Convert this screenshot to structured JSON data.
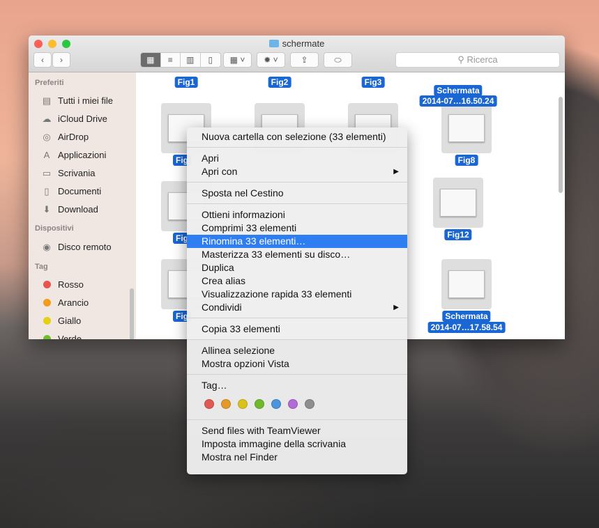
{
  "window": {
    "title": "schermate",
    "search_placeholder": "Ricerca"
  },
  "sidebar": {
    "sections": [
      {
        "title": "Preferiti",
        "items": [
          {
            "label": "Tutti i miei file",
            "icon": "all-files-icon"
          },
          {
            "label": "iCloud Drive",
            "icon": "cloud-icon"
          },
          {
            "label": "AirDrop",
            "icon": "airdrop-icon"
          },
          {
            "label": "Applicazioni",
            "icon": "applications-icon"
          },
          {
            "label": "Scrivania",
            "icon": "desktop-icon"
          },
          {
            "label": "Documenti",
            "icon": "documents-icon"
          },
          {
            "label": "Download",
            "icon": "download-icon"
          }
        ]
      },
      {
        "title": "Dispositivi",
        "items": [
          {
            "label": "Disco remoto",
            "icon": "disc-icon"
          }
        ]
      },
      {
        "title": "Tag",
        "items": [
          {
            "label": "Rosso",
            "color": "#e8534d"
          },
          {
            "label": "Arancio",
            "color": "#f39c1c"
          },
          {
            "label": "Giallo",
            "color": "#e6cf14"
          },
          {
            "label": "Verde",
            "color": "#6cc22a"
          }
        ]
      }
    ]
  },
  "files": {
    "fig1": "Fig1",
    "fig2": "Fig2",
    "fig3": "Fig3",
    "sch1a": "Schermata",
    "sch1b": "2014-07…16.50.24",
    "fig8": "Fig8",
    "fig12": "Fig12",
    "sch2a": "Schermata",
    "sch2b": "2014-07…17.58.54",
    "figA": "Fig",
    "figB": "Fig",
    "figC": "Fig"
  },
  "menu": {
    "new_folder": "Nuova cartella con selezione (33 elementi)",
    "open": "Apri",
    "open_with": "Apri con",
    "trash": "Sposta nel Cestino",
    "info": "Ottieni informazioni",
    "compress": "Comprimi 33 elementi",
    "rename": "Rinomina 33 elementi…",
    "burn": "Masterizza 33 elementi su disco…",
    "duplicate": "Duplica",
    "alias": "Crea alias",
    "quicklook": "Visualizzazione rapida 33 elementi",
    "share": "Condividi",
    "copy": "Copia 33 elementi",
    "align": "Allinea selezione",
    "view_options": "Mostra opzioni Vista",
    "tags": "Tag…",
    "tag_colors": [
      "#e05a55",
      "#e39a2a",
      "#d9c21c",
      "#71b92c",
      "#4a95dd",
      "#b36ad6",
      "#8e8e8e"
    ],
    "teamviewer": "Send files with TeamViewer",
    "desktop_image": "Imposta immagine della scrivania",
    "reveal": "Mostra nel Finder"
  }
}
